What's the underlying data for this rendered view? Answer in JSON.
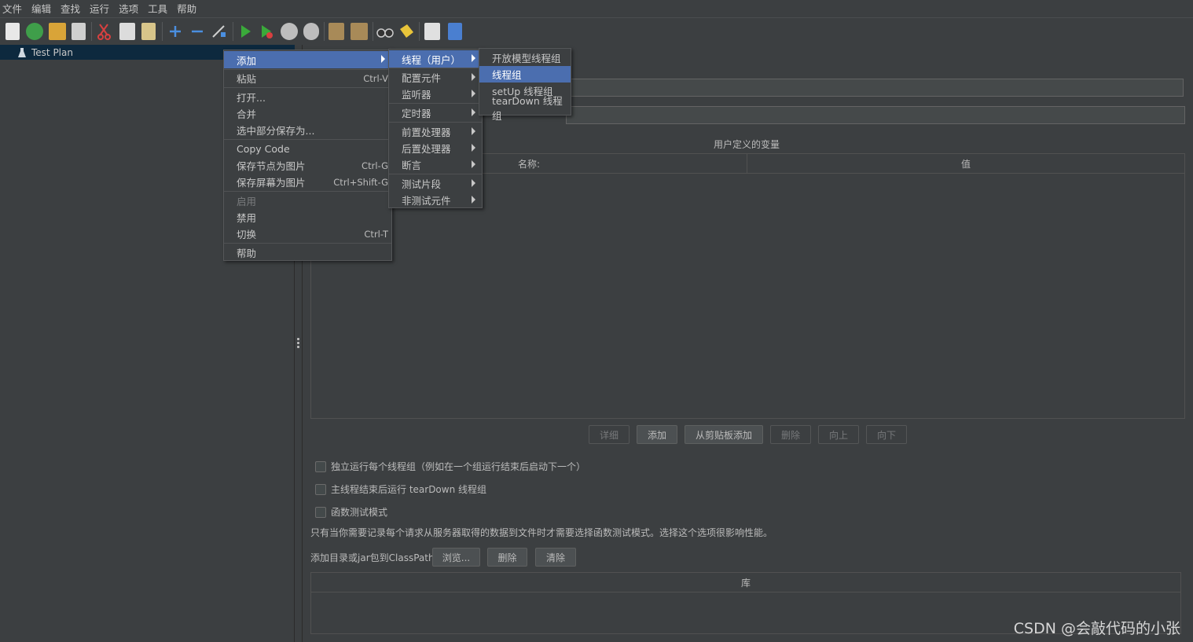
{
  "menubar": [
    "文件",
    "编辑",
    "查找",
    "运行",
    "选项",
    "工具",
    "帮助"
  ],
  "tree": {
    "root": "Test Plan"
  },
  "context_menu": {
    "add": "添加",
    "paste": "粘贴",
    "paste_acc": "Ctrl-V",
    "open": "打开...",
    "merge": "合并",
    "save_selection": "选中部分保存为...",
    "copy_code": "Copy Code",
    "save_node_img": "保存节点为图片",
    "save_node_img_acc": "Ctrl-G",
    "save_screen_img": "保存屏幕为图片",
    "save_screen_img_acc": "Ctrl+Shift-G",
    "enable": "启用",
    "disable": "禁用",
    "toggle": "切换",
    "toggle_acc": "Ctrl-T",
    "help": "帮助"
  },
  "add_submenu": {
    "threads": "线程（用户）",
    "config": "配置元件",
    "listener": "监听器",
    "timer": "定时器",
    "pre": "前置处理器",
    "post": "后置处理器",
    "assert": "断言",
    "fragment": "测试片段",
    "non_test": "非测试元件"
  },
  "threads_submenu": {
    "open_model": "开放模型线程组",
    "thread_group": "线程组",
    "setup": "setUp 线程组",
    "teardown": "tearDown 线程组"
  },
  "main": {
    "udv_title": "用户定义的变量",
    "col_name": "名称:",
    "col_value": "值",
    "buttons": {
      "detail": "详细",
      "add": "添加",
      "add_clipboard": "从剪贴板添加",
      "delete": "删除",
      "up": "向上",
      "down": "向下"
    },
    "checkbox_serial": "独立运行每个线程组（例如在一个组运行结束后启动下一个）",
    "checkbox_teardown": "主线程结束后运行 tearDown 线程组",
    "checkbox_functional": "函数测试模式",
    "functional_note": "只有当你需要记录每个请求从服务器取得的数据到文件时才需要选择函数测试模式。选择这个选项很影响性能。",
    "classpath_label": "添加目录或jar包到ClassPath",
    "browse": "浏览...",
    "cp_delete": "删除",
    "cp_clear": "清除",
    "lib_header": "库"
  },
  "watermark": "CSDN @会敲代码的小张"
}
